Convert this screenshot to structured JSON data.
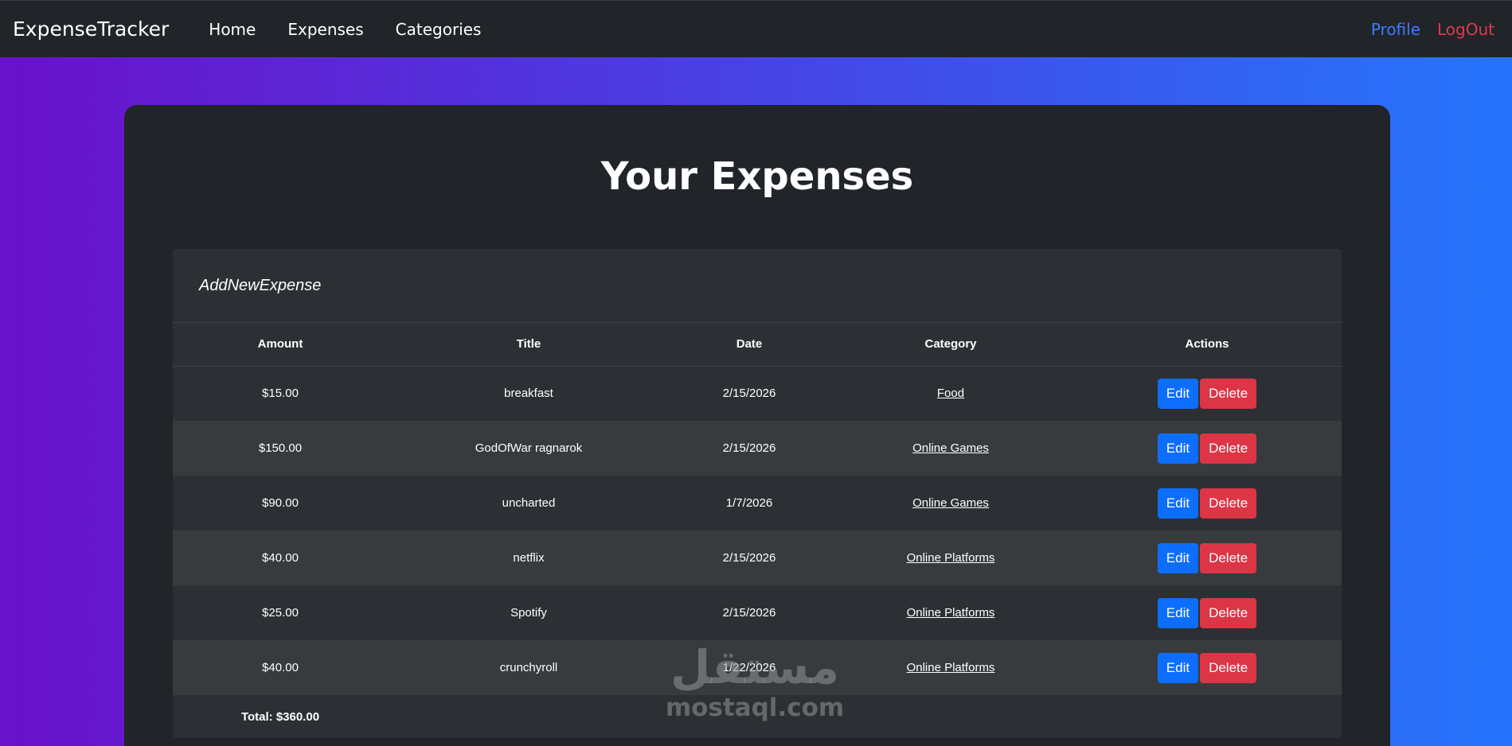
{
  "navbar": {
    "brand": "ExpenseTracker",
    "links": [
      "Home",
      "Expenses",
      "Categories"
    ],
    "profile": "Profile",
    "logout": "LogOut"
  },
  "main": {
    "title": "Your Expenses",
    "add_new": "AddNewExpense",
    "columns": [
      "Amount",
      "Title",
      "Date",
      "Category",
      "Actions"
    ],
    "rows": [
      {
        "amount": "$15.00",
        "title": "breakfast",
        "date": "2/15/2026",
        "category": "Food"
      },
      {
        "amount": "$150.00",
        "title": "GodOfWar ragnarok",
        "date": "2/15/2026",
        "category": "Online Games"
      },
      {
        "amount": "$90.00",
        "title": "uncharted",
        "date": "1/7/2026",
        "category": "Online Games"
      },
      {
        "amount": "$40.00",
        "title": "netflix",
        "date": "2/15/2026",
        "category": "Online Platforms"
      },
      {
        "amount": "$25.00",
        "title": "Spotify",
        "date": "2/15/2026",
        "category": "Online Platforms"
      },
      {
        "amount": "$40.00",
        "title": "crunchyroll",
        "date": "1/22/2026",
        "category": "Online Platforms"
      }
    ],
    "edit_label": "Edit",
    "delete_label": "Delete",
    "total": "Total: $360.00"
  },
  "watermark": {
    "arabic": "مستقل",
    "latin": "mostaql.com"
  },
  "colors": {
    "gradient_start": "#6a11cb",
    "gradient_end": "#2575fc",
    "edit": "#0d6efd",
    "delete": "#dc3545",
    "profile": "#3d7bff",
    "logout": "#e0394f"
  }
}
